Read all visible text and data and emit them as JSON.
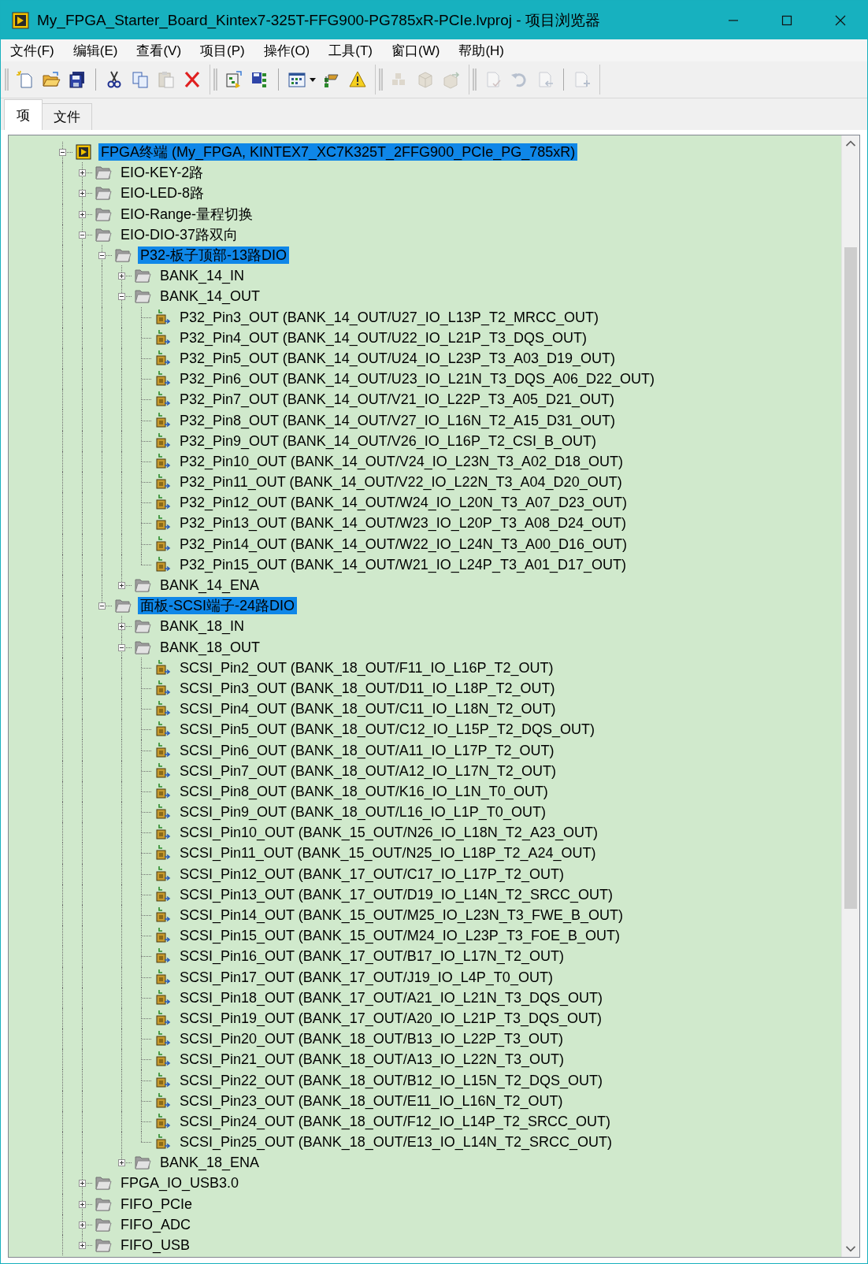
{
  "window": {
    "title": "My_FPGA_Starter_Board_Kintex7-325T-FFG900-PG785xR-PCIe.lvproj - 项目浏览器"
  },
  "menu": [
    "文件(F)",
    "编辑(E)",
    "查看(V)",
    "项目(P)",
    "操作(O)",
    "工具(T)",
    "窗口(W)",
    "帮助(H)"
  ],
  "toolbar": {
    "bands": [
      {
        "groups": [
          [
            {
              "kind": "new-file",
              "disabled": false
            },
            {
              "kind": "open-folder",
              "disabled": false
            },
            {
              "kind": "save-all",
              "disabled": false
            }
          ],
          [
            {
              "kind": "cut",
              "disabled": false
            },
            {
              "kind": "copy",
              "disabled": false
            },
            {
              "kind": "paste",
              "disabled": true
            },
            {
              "kind": "delete",
              "disabled": false
            }
          ]
        ]
      },
      {
        "groups": [
          [
            {
              "kind": "build",
              "disabled": false
            },
            {
              "kind": "save-tree",
              "disabled": false
            }
          ],
          [
            {
              "kind": "view-grid",
              "disabled": false
            },
            {
              "kind": "dropdown",
              "disabled": false
            },
            {
              "kind": "hierarchy",
              "disabled": false
            },
            {
              "kind": "warning",
              "disabled": false
            }
          ]
        ]
      },
      {
        "groups": [
          [
            {
              "kind": "cubes",
              "disabled": true
            },
            {
              "kind": "box",
              "disabled": true
            },
            {
              "kind": "box-arrow",
              "disabled": true
            }
          ]
        ]
      },
      {
        "groups": [
          [
            {
              "kind": "doc-check",
              "disabled": true
            },
            {
              "kind": "undo",
              "disabled": true
            },
            {
              "kind": "doc-left",
              "disabled": true
            }
          ],
          [
            {
              "kind": "doc-plus",
              "disabled": true
            }
          ]
        ]
      }
    ]
  },
  "tabs": [
    {
      "label": "项",
      "selected": true
    },
    {
      "label": "文件",
      "selected": false
    }
  ],
  "tree": {
    "items": [
      {
        "label": "FPGA终端 (My_FPGA, KINTEX7_XC7K325T_2FFG900_PCIe_PG_785xR)",
        "kind": "target",
        "expanded": true,
        "selected": true,
        "children": [
          {
            "label": "EIO-KEY-2路",
            "kind": "folder",
            "expanded": false,
            "selected": false
          },
          {
            "label": "EIO-LED-8路",
            "kind": "folder",
            "expanded": false,
            "selected": false
          },
          {
            "label": "EIO-Range-量程切换",
            "kind": "folder",
            "expanded": false,
            "selected": false
          },
          {
            "label": "EIO-DIO-37路双向",
            "kind": "folder",
            "expanded": true,
            "selected": false,
            "children": [
              {
                "label": "P32-板子顶部-13路DIO",
                "kind": "folder",
                "expanded": true,
                "selected": true,
                "children": [
                  {
                    "label": "BANK_14_IN",
                    "kind": "folder",
                    "expanded": false,
                    "selected": false
                  },
                  {
                    "label": "BANK_14_OUT",
                    "kind": "folder",
                    "expanded": true,
                    "selected": false,
                    "children": [
                      {
                        "label": "P32_Pin3_OUT (BANK_14_OUT/U27_IO_L13P_T2_MRCC_OUT)",
                        "kind": "io",
                        "selected": false
                      },
                      {
                        "label": "P32_Pin4_OUT (BANK_14_OUT/U22_IO_L21P_T3_DQS_OUT)",
                        "kind": "io",
                        "selected": false
                      },
                      {
                        "label": "P32_Pin5_OUT (BANK_14_OUT/U24_IO_L23P_T3_A03_D19_OUT)",
                        "kind": "io",
                        "selected": false
                      },
                      {
                        "label": "P32_Pin6_OUT (BANK_14_OUT/U23_IO_L21N_T3_DQS_A06_D22_OUT)",
                        "kind": "io",
                        "selected": false
                      },
                      {
                        "label": "P32_Pin7_OUT (BANK_14_OUT/V21_IO_L22P_T3_A05_D21_OUT)",
                        "kind": "io",
                        "selected": false
                      },
                      {
                        "label": "P32_Pin8_OUT (BANK_14_OUT/V27_IO_L16N_T2_A15_D31_OUT)",
                        "kind": "io",
                        "selected": false
                      },
                      {
                        "label": "P32_Pin9_OUT (BANK_14_OUT/V26_IO_L16P_T2_CSI_B_OUT)",
                        "kind": "io",
                        "selected": false
                      },
                      {
                        "label": "P32_Pin10_OUT (BANK_14_OUT/V24_IO_L23N_T3_A02_D18_OUT)",
                        "kind": "io",
                        "selected": false
                      },
                      {
                        "label": "P32_Pin11_OUT (BANK_14_OUT/V22_IO_L22N_T3_A04_D20_OUT)",
                        "kind": "io",
                        "selected": false
                      },
                      {
                        "label": "P32_Pin12_OUT (BANK_14_OUT/W24_IO_L20N_T3_A07_D23_OUT)",
                        "kind": "io",
                        "selected": false
                      },
                      {
                        "label": "P32_Pin13_OUT (BANK_14_OUT/W23_IO_L20P_T3_A08_D24_OUT)",
                        "kind": "io",
                        "selected": false
                      },
                      {
                        "label": "P32_Pin14_OUT (BANK_14_OUT/W22_IO_L24N_T3_A00_D16_OUT)",
                        "kind": "io",
                        "selected": false
                      },
                      {
                        "label": "P32_Pin15_OUT (BANK_14_OUT/W21_IO_L24P_T3_A01_D17_OUT)",
                        "kind": "io",
                        "selected": false
                      }
                    ]
                  },
                  {
                    "label": "BANK_14_ENA",
                    "kind": "folder",
                    "expanded": false,
                    "selected": false
                  }
                ]
              },
              {
                "label": "面板-SCSI端子-24路DIO",
                "kind": "folder",
                "expanded": true,
                "selected": true,
                "children": [
                  {
                    "label": "BANK_18_IN",
                    "kind": "folder",
                    "expanded": false,
                    "selected": false
                  },
                  {
                    "label": "BANK_18_OUT",
                    "kind": "folder",
                    "expanded": true,
                    "selected": false,
                    "children": [
                      {
                        "label": "SCSI_Pin2_OUT (BANK_18_OUT/F11_IO_L16P_T2_OUT)",
                        "kind": "io",
                        "selected": false
                      },
                      {
                        "label": "SCSI_Pin3_OUT (BANK_18_OUT/D11_IO_L18P_T2_OUT)",
                        "kind": "io",
                        "selected": false
                      },
                      {
                        "label": "SCSI_Pin4_OUT (BANK_18_OUT/C11_IO_L18N_T2_OUT)",
                        "kind": "io",
                        "selected": false
                      },
                      {
                        "label": "SCSI_Pin5_OUT (BANK_18_OUT/C12_IO_L15P_T2_DQS_OUT)",
                        "kind": "io",
                        "selected": false
                      },
                      {
                        "label": "SCSI_Pin6_OUT (BANK_18_OUT/A11_IO_L17P_T2_OUT)",
                        "kind": "io",
                        "selected": false
                      },
                      {
                        "label": "SCSI_Pin7_OUT (BANK_18_OUT/A12_IO_L17N_T2_OUT)",
                        "kind": "io",
                        "selected": false
                      },
                      {
                        "label": "SCSI_Pin8_OUT (BANK_18_OUT/K16_IO_L1N_T0_OUT)",
                        "kind": "io",
                        "selected": false
                      },
                      {
                        "label": "SCSI_Pin9_OUT (BANK_18_OUT/L16_IO_L1P_T0_OUT)",
                        "kind": "io",
                        "selected": false
                      },
                      {
                        "label": "SCSI_Pin10_OUT (BANK_15_OUT/N26_IO_L18N_T2_A23_OUT)",
                        "kind": "io",
                        "selected": false
                      },
                      {
                        "label": "SCSI_Pin11_OUT (BANK_15_OUT/N25_IO_L18P_T2_A24_OUT)",
                        "kind": "io",
                        "selected": false
                      },
                      {
                        "label": "SCSI_Pin12_OUT (BANK_17_OUT/C17_IO_L17P_T2_OUT)",
                        "kind": "io",
                        "selected": false
                      },
                      {
                        "label": "SCSI_Pin13_OUT (BANK_17_OUT/D19_IO_L14N_T2_SRCC_OUT)",
                        "kind": "io",
                        "selected": false
                      },
                      {
                        "label": "SCSI_Pin14_OUT (BANK_15_OUT/M25_IO_L23N_T3_FWE_B_OUT)",
                        "kind": "io",
                        "selected": false
                      },
                      {
                        "label": "SCSI_Pin15_OUT (BANK_15_OUT/M24_IO_L23P_T3_FOE_B_OUT)",
                        "kind": "io",
                        "selected": false
                      },
                      {
                        "label": "SCSI_Pin16_OUT (BANK_17_OUT/B17_IO_L17N_T2_OUT)",
                        "kind": "io",
                        "selected": false
                      },
                      {
                        "label": "SCSI_Pin17_OUT (BANK_17_OUT/J19_IO_L4P_T0_OUT)",
                        "kind": "io",
                        "selected": false
                      },
                      {
                        "label": "SCSI_Pin18_OUT (BANK_17_OUT/A21_IO_L21N_T3_DQS_OUT)",
                        "kind": "io",
                        "selected": false
                      },
                      {
                        "label": "SCSI_Pin19_OUT (BANK_17_OUT/A20_IO_L21P_T3_DQS_OUT)",
                        "kind": "io",
                        "selected": false
                      },
                      {
                        "label": "SCSI_Pin20_OUT (BANK_18_OUT/B13_IO_L22P_T3_OUT)",
                        "kind": "io",
                        "selected": false
                      },
                      {
                        "label": "SCSI_Pin21_OUT (BANK_18_OUT/A13_IO_L22N_T3_OUT)",
                        "kind": "io",
                        "selected": false
                      },
                      {
                        "label": "SCSI_Pin22_OUT (BANK_18_OUT/B12_IO_L15N_T2_DQS_OUT)",
                        "kind": "io",
                        "selected": false
                      },
                      {
                        "label": "SCSI_Pin23_OUT (BANK_18_OUT/E11_IO_L16N_T2_OUT)",
                        "kind": "io",
                        "selected": false
                      },
                      {
                        "label": "SCSI_Pin24_OUT (BANK_18_OUT/F12_IO_L14P_T2_SRCC_OUT)",
                        "kind": "io",
                        "selected": false
                      },
                      {
                        "label": "SCSI_Pin25_OUT (BANK_18_OUT/E13_IO_L14N_T2_SRCC_OUT)",
                        "kind": "io",
                        "selected": false
                      }
                    ]
                  },
                  {
                    "label": "BANK_18_ENA",
                    "kind": "folder",
                    "expanded": false,
                    "selected": false
                  }
                ]
              }
            ]
          },
          {
            "label": "FPGA_IO_USB3.0",
            "kind": "folder",
            "expanded": false,
            "selected": false
          },
          {
            "label": "FIFO_PCIe",
            "kind": "folder",
            "expanded": false,
            "selected": false
          },
          {
            "label": "FIFO_ADC",
            "kind": "folder",
            "expanded": false,
            "selected": false
          },
          {
            "label": "FIFO_USB",
            "kind": "folder",
            "expanded": false,
            "selected": false
          }
        ]
      }
    ]
  }
}
